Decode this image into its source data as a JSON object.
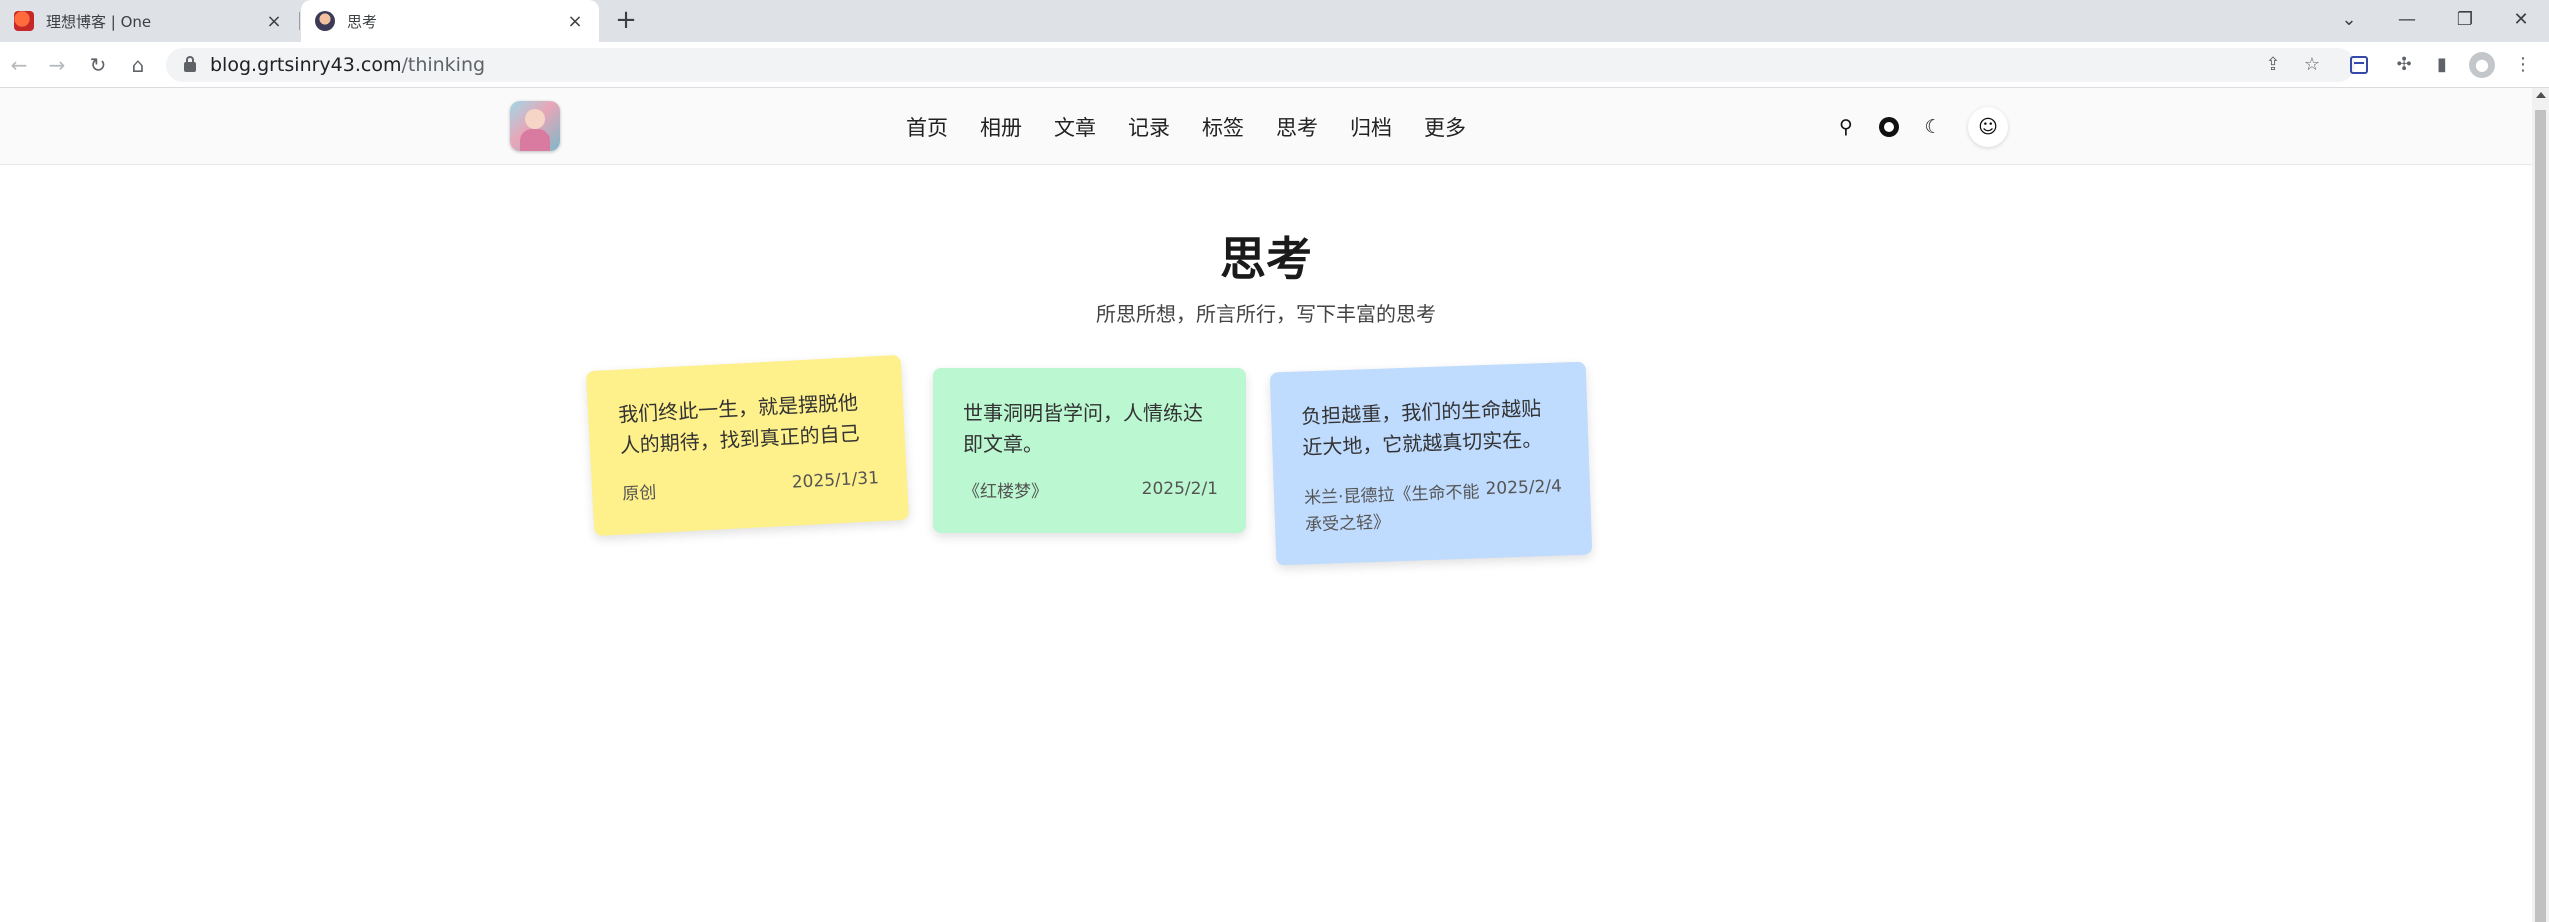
{
  "browser": {
    "tabs": [
      {
        "title": "理想博客 | One",
        "active": false
      },
      {
        "title": "思考",
        "active": true
      }
    ],
    "new_tab": "+",
    "url_host": "blog.grtsinry43.com",
    "url_path": "/thinking",
    "window_controls": {
      "dropdown": "⌄",
      "minimize": "—",
      "restore": "❐",
      "close": "✕"
    }
  },
  "site": {
    "nav": [
      "首页",
      "相册",
      "文章",
      "记录",
      "标签",
      "思考",
      "归档",
      "更多"
    ],
    "header_icons": [
      "search-icon",
      "github-icon",
      "theme-toggle-icon",
      "user-add-icon"
    ]
  },
  "page": {
    "title": "思考",
    "subtitle": "所思所想，所言所行，写下丰富的思考"
  },
  "notes": [
    {
      "text": "我们终此一生，就是摆脱他人的期待，找到真正的自己",
      "source": "原创",
      "date": "2025/1/31",
      "color": "#fef08a"
    },
    {
      "text": "世事洞明皆学问，人情练达即文章。",
      "source": "《红楼梦》",
      "date": "2025/2/1",
      "color": "#bbf7d0"
    },
    {
      "text": "负担越重，我们的生命越贴近大地，它就越真切实在。",
      "source": "米兰·昆德拉《生命不能承受之轻》",
      "date": "2025/2/4",
      "color": "#bfdbfe"
    }
  ]
}
